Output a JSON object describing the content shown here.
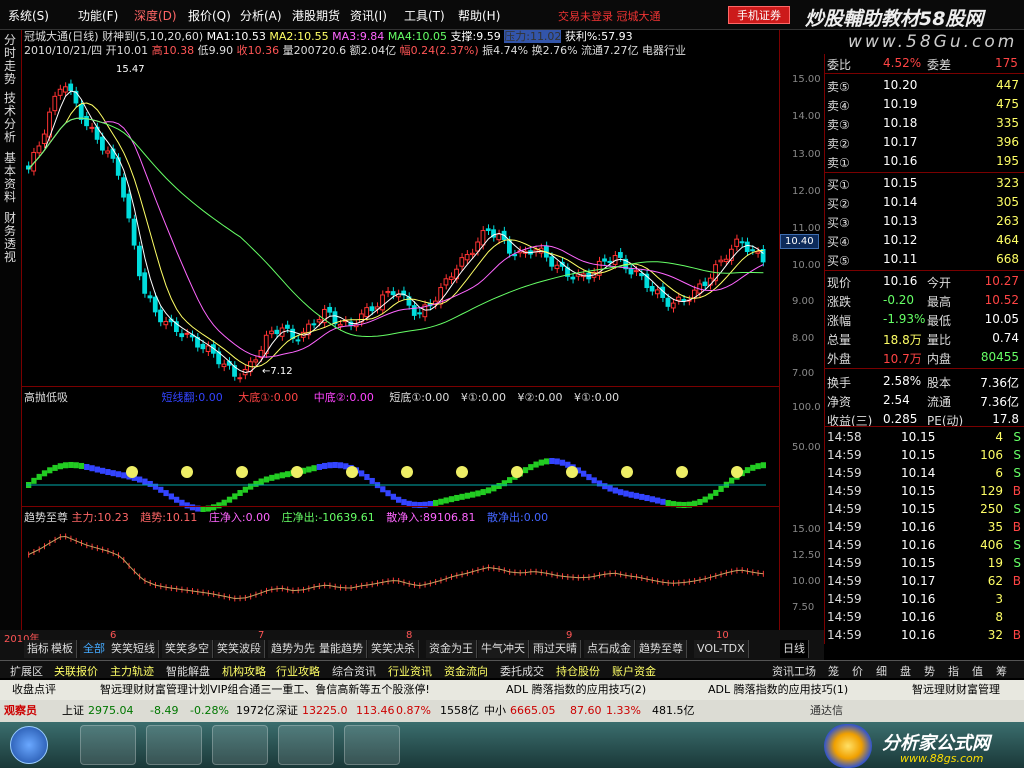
{
  "menu": [
    "系统(S)",
    "功能(F)",
    "深度(D)",
    "报价(Q)",
    "分析(A)",
    "港股期货",
    "资讯(I)",
    "工具(T)",
    "帮助(H)"
  ],
  "login_notice": "交易未登录",
  "brand_name": "冠城大通",
  "mobile_button": "手机证券",
  "watermark": "炒股輔助教材58股网",
  "watermark_url": "www.58Gu.com",
  "side_tabs": [
    "分时走势",
    "技术分析",
    "基本资料",
    "财务透视"
  ],
  "stock_line": {
    "name": "冠城大通(日线)",
    "ma": "财神到(5,10,20,60)",
    "ma1": "MA1:10.53",
    "ma2": "MA2:10.55",
    "ma3": "MA3:9.84",
    "ma4": "MA4:10.05",
    "support": "支撑:9.59",
    "pressure": "压力:11.02",
    "profit": "获利%:57.93"
  },
  "day_line": {
    "date": "2010/10/21/四",
    "open": "开10.01",
    "high": "高10.38",
    "low": "低9.90",
    "close": "收10.36",
    "volume": "量200720.6",
    "amount": "额2.04亿",
    "amplitude_chg": "幅0.24(2.37%)",
    "swing": "振4.74%",
    "turnover": "换2.76%",
    "float": "流通7.27亿",
    "sector": "电器行业"
  },
  "price_labels": {
    "high": "15.47",
    "low": "←7.12",
    "current": "10.40"
  },
  "price_ticks": [
    "15.00",
    "14.00",
    "13.00",
    "12.00",
    "11.00",
    "10.00",
    "9.00",
    "8.00",
    "7.00"
  ],
  "indicator1": {
    "title": "高抛低吸",
    "a": "短线翻:0.00",
    "b": "大底①:0.00",
    "c": "中底②:0.00",
    "d": "短底①:0.00",
    "e": "¥①:0.00",
    "f": "¥②:0.00",
    "g": "¥①:0.00",
    "ticks": [
      "100.0",
      "50.00"
    ]
  },
  "indicator2": {
    "title": "趋势至尊",
    "main": "主力:10.23",
    "trend": "趋势:10.11",
    "in": "庄净入:0.00",
    "out": "庄净出:-10639.61",
    "retail_in": "散净入:89106.81",
    "retail_out": "散净出:0.00",
    "ticks": [
      "15.00",
      "12.50",
      "10.00",
      "7.50"
    ]
  },
  "x_labels": [
    "2010年",
    "6",
    "7",
    "8",
    "9",
    "10"
  ],
  "quote": {
    "weibi_label": "委比",
    "weibi": "4.52%",
    "weicha_label": "委差",
    "weicha": "175",
    "sells": [
      {
        "label": "卖⑤",
        "price": "10.20",
        "vol": "447"
      },
      {
        "label": "卖④",
        "price": "10.19",
        "vol": "475"
      },
      {
        "label": "卖③",
        "price": "10.18",
        "vol": "335"
      },
      {
        "label": "卖②",
        "price": "10.17",
        "vol": "396"
      },
      {
        "label": "卖①",
        "price": "10.16",
        "vol": "195"
      }
    ],
    "buys": [
      {
        "label": "买①",
        "price": "10.15",
        "vol": "323"
      },
      {
        "label": "买②",
        "price": "10.14",
        "vol": "305"
      },
      {
        "label": "买③",
        "price": "10.13",
        "vol": "263"
      },
      {
        "label": "买④",
        "price": "10.12",
        "vol": "464"
      },
      {
        "label": "买⑤",
        "price": "10.11",
        "vol": "668"
      }
    ],
    "stats": [
      [
        "现价",
        "10.16",
        "今开",
        "10.27"
      ],
      [
        "涨跌",
        "-0.20",
        "最高",
        "10.52"
      ],
      [
        "涨幅",
        "-1.93%",
        "最低",
        "10.05"
      ],
      [
        "总量",
        "18.8万",
        "量比",
        "0.74"
      ],
      [
        "外盘",
        "10.7万",
        "内盘",
        "80455"
      ],
      [
        "换手",
        "2.58%",
        "股本",
        "7.36亿"
      ],
      [
        "净资",
        "2.54",
        "流通",
        "7.36亿"
      ],
      [
        "收益(三)",
        "0.285",
        "PE(动)",
        "17.8"
      ]
    ],
    "ticks": [
      [
        "14:58",
        "10.15",
        "4",
        "S"
      ],
      [
        "14:59",
        "10.15",
        "106",
        "S"
      ],
      [
        "14:59",
        "10.14",
        "6",
        "S"
      ],
      [
        "14:59",
        "10.15",
        "129",
        "B"
      ],
      [
        "14:59",
        "10.15",
        "250",
        "S"
      ],
      [
        "14:59",
        "10.16",
        "35",
        "B"
      ],
      [
        "14:59",
        "10.16",
        "406",
        "S"
      ],
      [
        "14:59",
        "10.15",
        "19",
        "S"
      ],
      [
        "14:59",
        "10.17",
        "62",
        "B"
      ],
      [
        "14:59",
        "10.16",
        "3",
        ""
      ],
      [
        "14:59",
        "10.16",
        "8",
        ""
      ],
      [
        "14:59",
        "10.16",
        "32",
        "B"
      ]
    ]
  },
  "bottom_tabs": [
    "指标",
    "模板",
    "全部",
    "笑笑短线",
    "笑笑多空",
    "笑笑波段",
    "趋势为先",
    "量能趋势",
    "笑笑决杀",
    "资金为王",
    "牛气冲天",
    "雨过天晴",
    "点石成金",
    "趋势至尊",
    "VOL-TDX",
    "日线"
  ],
  "nav_items": [
    "扩展区",
    "关联报价",
    "主力轨迹",
    "智能解盘",
    "机构攻略",
    "行业攻略",
    "综合资讯",
    "行业资讯",
    "资金流向",
    "委托成交",
    "持仓股份",
    "账户资金"
  ],
  "right_tabs": [
    "资讯工场",
    "笼",
    "价",
    "细",
    "盘",
    "势",
    "指",
    "值",
    "筹"
  ],
  "news_items": [
    "收盘点评",
    "智远理财财富管理计划VIP组合通三一重工、鲁信高新等五个股涨停!",
    "ADL 腾落指数的应用技巧(2)",
    "ADL 腾落指数的应用技巧(1)",
    "智远理财财富管理"
  ],
  "status": {
    "role": "观察员",
    "sh_label": "上证",
    "sh": "2975.04",
    "sh_chg": "-8.49",
    "sh_pct": "-0.28%",
    "sh_amt": "1972亿",
    "sz_label": "深证",
    "sz": "13225.0",
    "sz_chg": "113.46",
    "sz_pct": "0.87%",
    "sz_amt": "1558亿",
    "zx_label": "中小",
    "zx": "6665.05",
    "zx_chg": "87.60",
    "zx_pct": "1.33%",
    "zx_amt": "481.5亿",
    "tail": "通达信",
    "site": "分析家公式网",
    "site_url": "www.88gs.com"
  }
}
